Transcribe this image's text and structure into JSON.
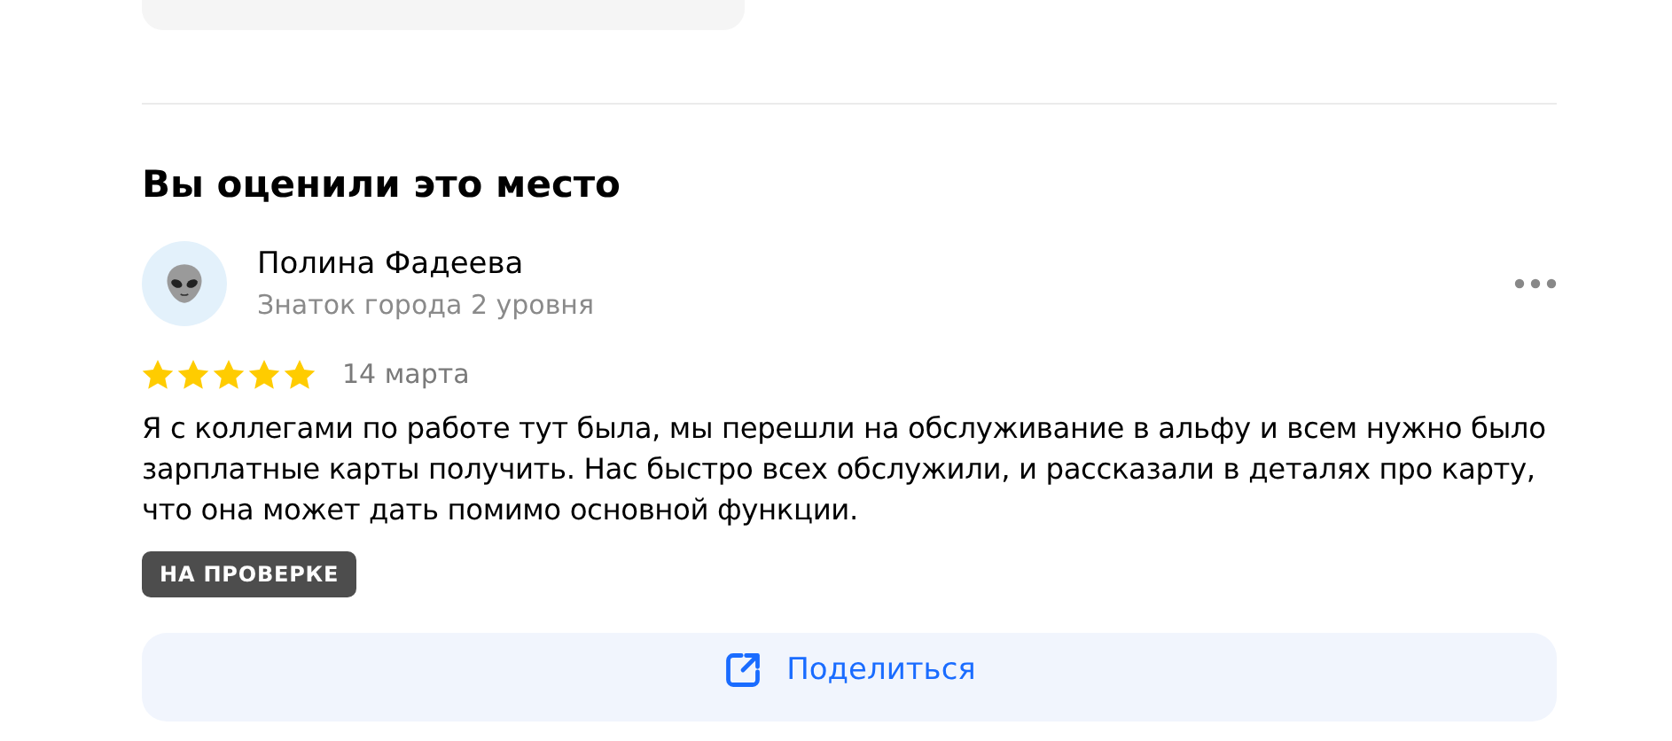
{
  "heading": "Вы оценили это место",
  "review": {
    "author": "Полина Фадеева",
    "author_level": "Знаток города 2 уровня",
    "stars": 5,
    "date": "14 марта",
    "text": "Я с коллегами по работе тут была, мы перешли на обслуживание в альфу и всем нужно было зарплатные карты получить. Нас быстро всех обслужили, и рассказали в деталях про карту, что она может дать помимо основной функции.",
    "status": "НА ПРОВЕРКЕ"
  },
  "share_button": "Поделиться"
}
